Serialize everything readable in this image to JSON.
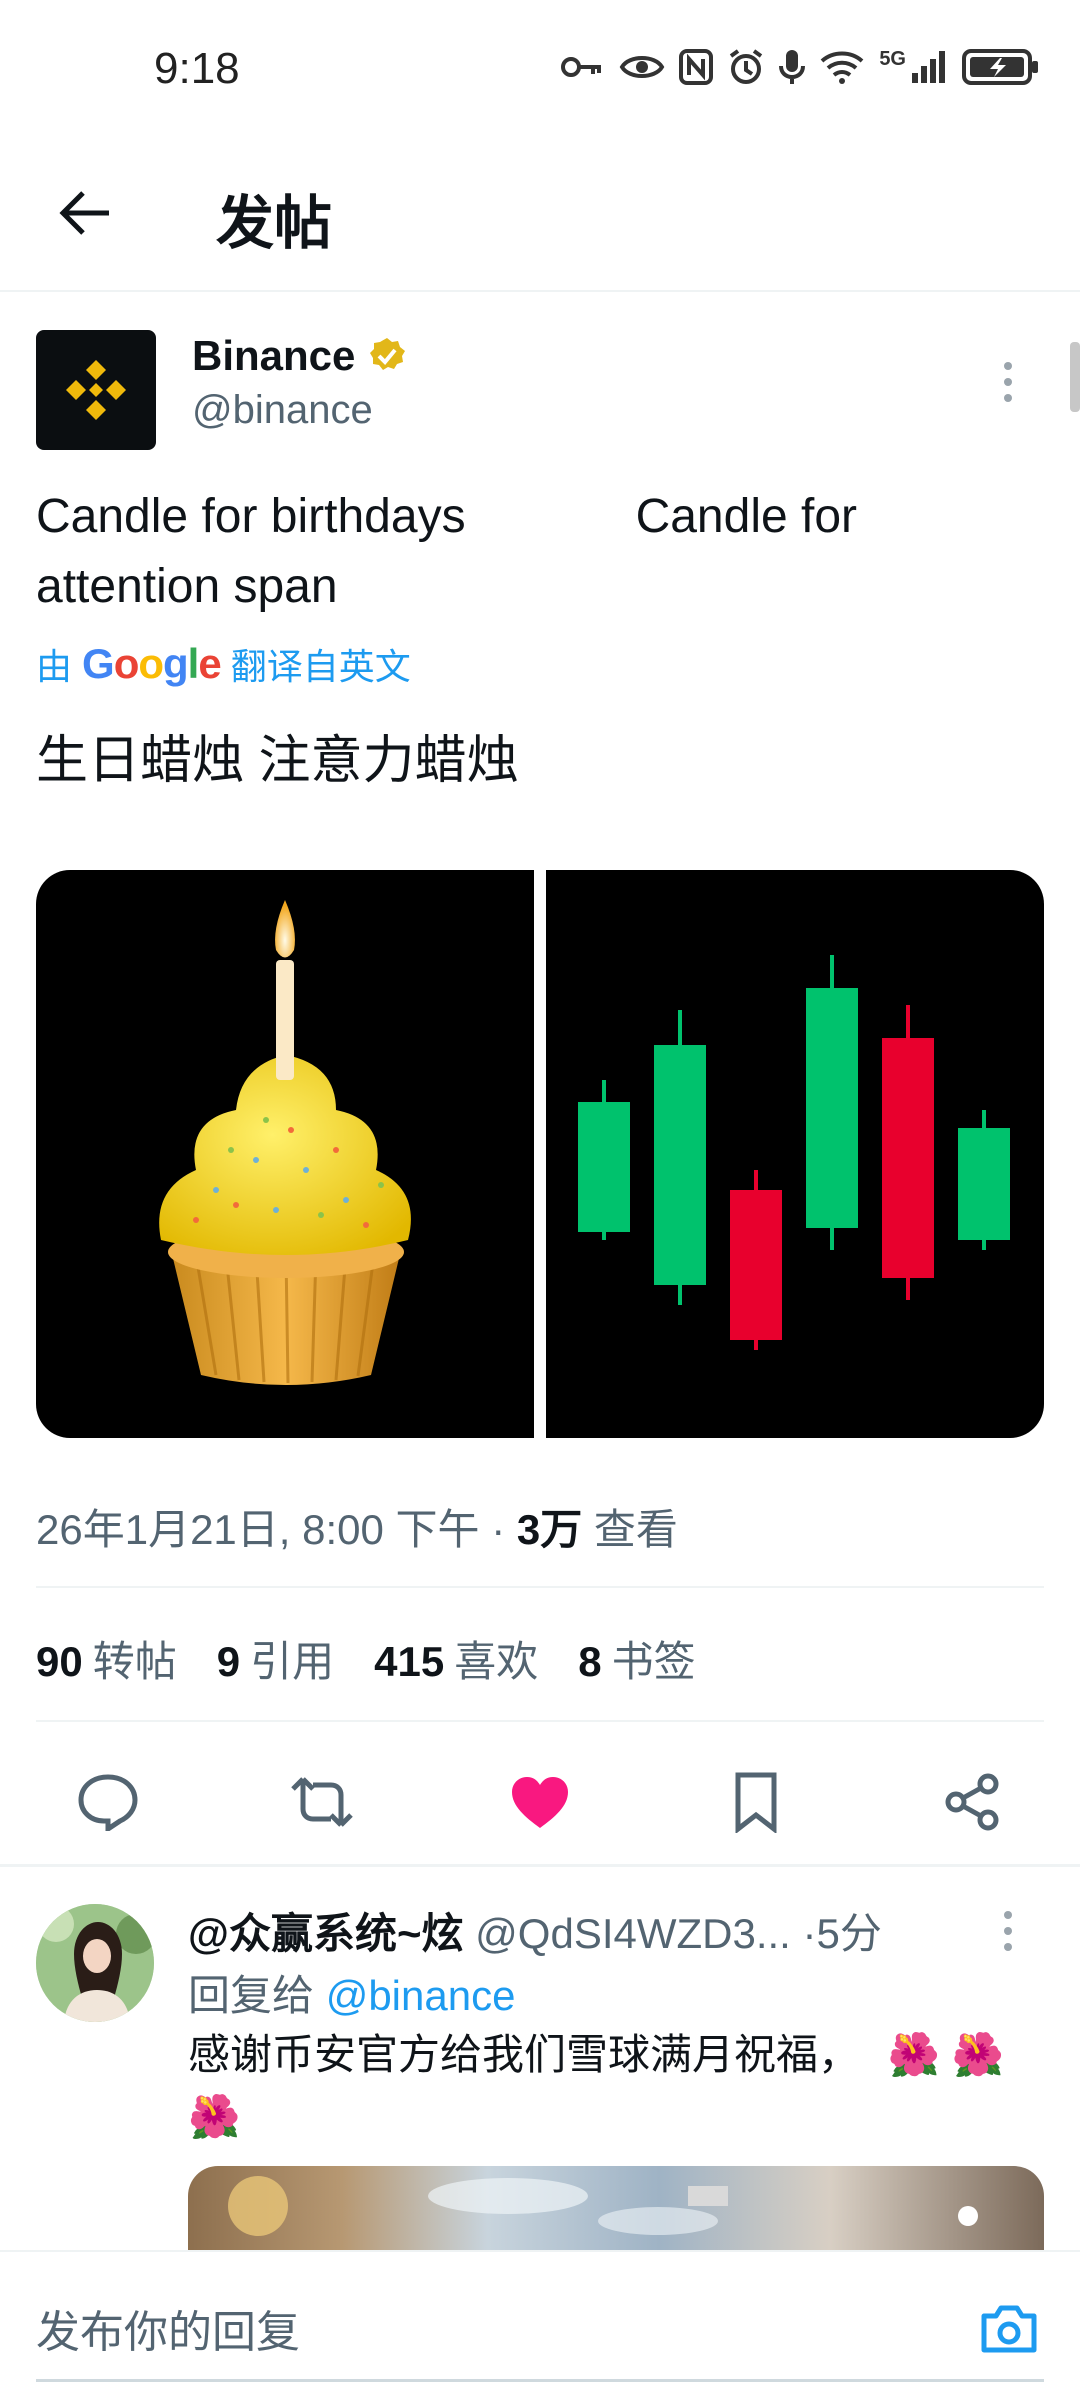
{
  "status_bar": {
    "time": "9:18",
    "network": "5G",
    "icons": [
      "key-icon",
      "eye-icon",
      "nfc-icon",
      "alarm-icon",
      "mic-icon",
      "wifi-icon",
      "signal-icon",
      "battery-icon"
    ]
  },
  "header": {
    "title": "发帖",
    "back_icon": "arrow-left-icon"
  },
  "tweet": {
    "author_name": "Binance",
    "author_handle": "@binance",
    "verified": true,
    "text_en_part1": "Candle for birthdays",
    "text_en_part2": "Candle for attention span",
    "translate_prefix": "由",
    "translate_brand": "Google",
    "translate_suffix": "翻译自英文",
    "text_zh": "生日蜡烛 注意力蜡烛",
    "timestamp": "26年1月21日, 8:00 下午",
    "separator": "·",
    "views_count": "3万",
    "views_label": "查看",
    "stats": [
      {
        "count": "90",
        "label": "转帖"
      },
      {
        "count": "9",
        "label": "引用"
      },
      {
        "count": "415",
        "label": "喜欢"
      },
      {
        "count": "8",
        "label": "书签"
      }
    ],
    "actions": [
      "reply-icon",
      "retweet-icon",
      "heart-icon",
      "bookmark-icon",
      "share-icon"
    ],
    "liked": true,
    "colors": {
      "like": "#f91880",
      "accent": "#1d9bf0",
      "candle_up": "#00c26d",
      "candle_down": "#e8002d",
      "cupcake": "#f5d10a"
    }
  },
  "reply": {
    "author_name": "@众赢系统~炫",
    "author_handle": "@QdSI4WZD3...",
    "time": "5分",
    "separator": "·",
    "reply_to_label": "回复给",
    "reply_to_mention": "@binance",
    "text": "感谢币安官方给我们雪球满月祝福，",
    "emoji_line1": "🌺 🌺",
    "emoji_line2": "🌺"
  },
  "compose": {
    "placeholder": "发布你的回复"
  }
}
